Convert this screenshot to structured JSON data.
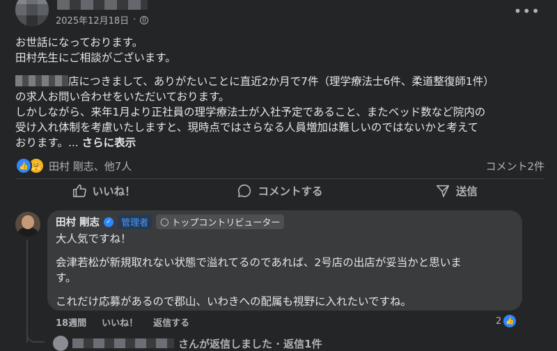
{
  "post": {
    "date": "2025年12月18日",
    "privacy_icon": "globe-icon",
    "more_icon": "more-icon",
    "line1": "お世話になっております。",
    "line2": "田村先生にご相談がございます。",
    "para2_suffix": "店につきまして、ありがたいことに直近2か月で7件（理学療法士6件、柔道整復師1件）",
    "para2_line2": "の求人お問い合わせをいただいております。",
    "para3_line1": "しかしながら、来年1月より正社員の理学療法士が入社予定であること、またベッド数など院内の",
    "para3_line2": "受け入れ体制を考慮いたしますと、現時点ではさらなる人員増加は難しいのではないかと考えて",
    "para3_line3": "おります。... ",
    "see_more": "さらに表示"
  },
  "reactions": {
    "names": "田村 剛志、他7人",
    "comment_count": "コメント2件"
  },
  "actions": {
    "like": "いいね！",
    "comment": "コメントする",
    "share": "送信"
  },
  "comment": {
    "author": "田村 剛志",
    "admin_badge": "管理者",
    "top_badge": "トップコントリビューター",
    "text1": "大人気ですね！",
    "text2_line1": "会津若松が新規取れない状態で溢れてるのであれば、2号店の出店が妥当かと思いま",
    "text2_line2": "す。",
    "text3": "これだけ応募があるので郡山、いわきへの配属も視野に入れたいですね。",
    "time": "18週間",
    "like_label": "いいね！",
    "reply_label": "返信する",
    "like_count": "2"
  },
  "reply_summary": {
    "text": "さんが返信しました · 返信1件"
  },
  "colors": {
    "background": "#242526",
    "bubble": "#3a3b3c",
    "accent": "#2d88ff",
    "text": "#e4e6eb",
    "muted": "#b0b3b8"
  }
}
